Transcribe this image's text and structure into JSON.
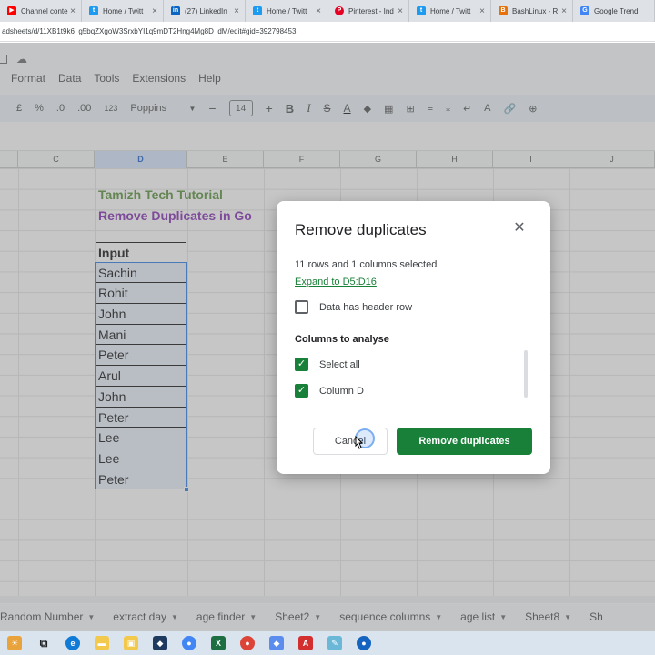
{
  "browser": {
    "tabs": [
      {
        "title": "Channel conte",
        "icon": "youtube-icon",
        "color": "#ff0000"
      },
      {
        "title": "Home / Twitt",
        "icon": "twitter-icon",
        "color": "#1d9bf0"
      },
      {
        "title": "(27) LinkedIn",
        "icon": "linkedin-icon",
        "color": "#0a66c2"
      },
      {
        "title": "Home / Twitt",
        "icon": "twitter-icon",
        "color": "#1d9bf0"
      },
      {
        "title": "Pinterest - Ind",
        "icon": "pinterest-icon",
        "color": "#e60023"
      },
      {
        "title": "Home / Twitt",
        "icon": "twitter-icon",
        "color": "#1d9bf0"
      },
      {
        "title": "BashLinux - R",
        "icon": "bashlinux-icon",
        "color": "#e8710a"
      },
      {
        "title": "Google Trend",
        "icon": "google-icon",
        "color": "#4285f4"
      }
    ],
    "url": "adsheets/d/11XB1t9k6_g5bqZXgoW3SrxbYI1q9mDT2Hng4Mg8D_dM/edit#gid=392798453"
  },
  "sheets": {
    "menu": [
      "Format",
      "Data",
      "Tools",
      "Extensions",
      "Help"
    ],
    "toolbar": {
      "currency": "£",
      "percent": "%",
      "dec_less": ".0",
      "dec_more": ".00",
      "number_format": "123",
      "font": "Poppins",
      "font_size": "14",
      "bold": "B",
      "italic": "I",
      "strike": "S",
      "text_color": "A"
    },
    "columns": [
      "C",
      "D",
      "E",
      "F",
      "G",
      "H",
      "I",
      "J"
    ],
    "selected_column": "D",
    "title1": "Tamizh Tech Tutorial",
    "title2": "Remove Duplicates in Go",
    "header_cell": "Input",
    "data_cells": [
      "Sachin",
      "Rohit",
      "John",
      "Mani",
      "Peter",
      "Arul",
      "John",
      "Peter",
      "Lee",
      "Lee",
      "Peter"
    ],
    "sheet_tabs": [
      "Random Number",
      "extract day",
      "age finder",
      "Sheet2",
      "sequence columns",
      "age list",
      "Sheet8",
      "Sh"
    ]
  },
  "dialog": {
    "title": "Remove duplicates",
    "summary": "11 rows and 1 columns selected",
    "expand_link": "Expand to D5:D16",
    "header_row_label": "Data has header row",
    "header_row_checked": false,
    "columns_heading": "Columns to analyse",
    "options": [
      {
        "label": "Select all",
        "checked": true
      },
      {
        "label": "Column D",
        "checked": true
      }
    ],
    "cancel_label": "Cancel",
    "confirm_label": "Remove duplicates",
    "accent": "#188038"
  }
}
